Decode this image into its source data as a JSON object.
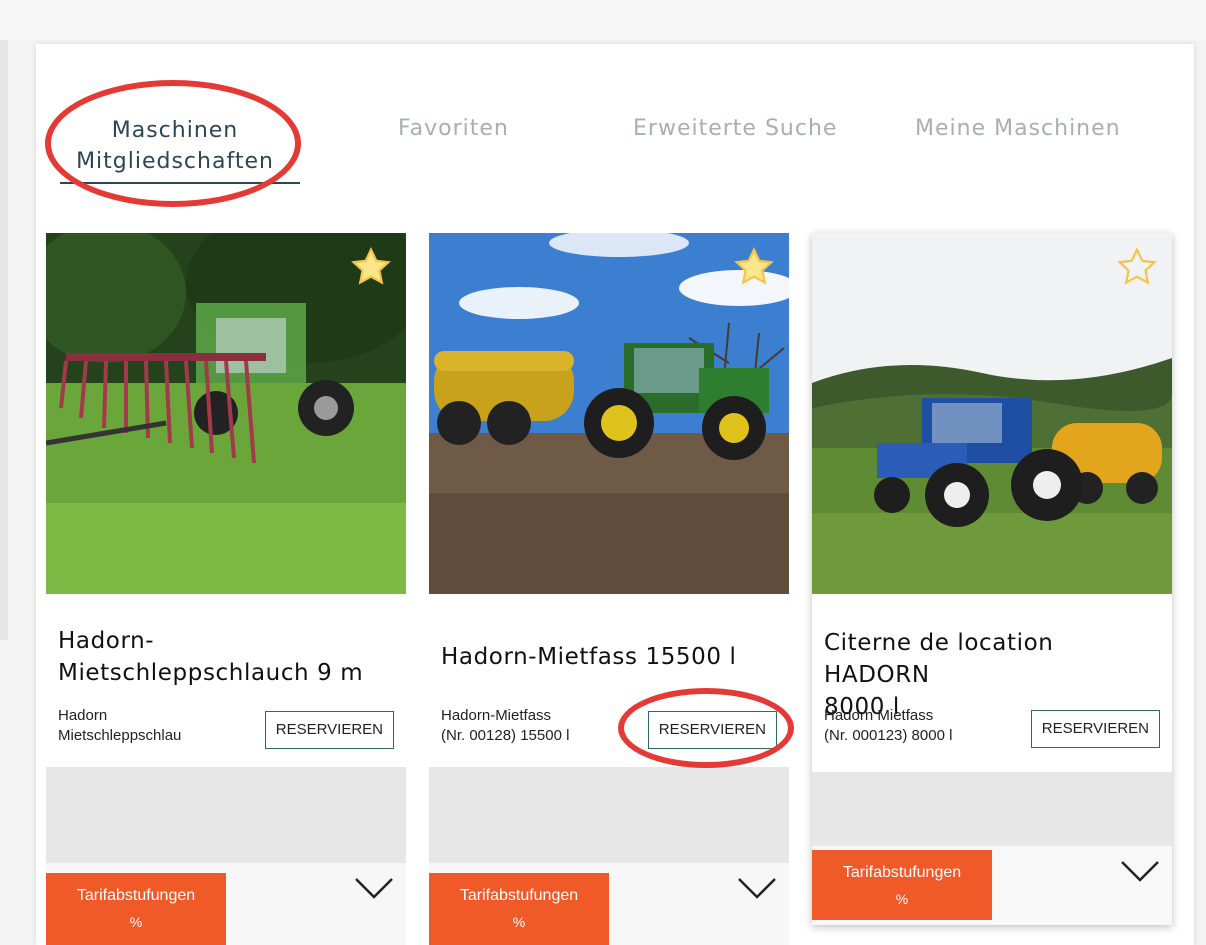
{
  "tabs": [
    {
      "label_line1": "Maschinen",
      "label_line2": "Mitgliedschaften",
      "active": true
    },
    {
      "label": "Favoriten"
    },
    {
      "label": "Erweiterte Suche"
    },
    {
      "label": "Meine Maschinen"
    }
  ],
  "cards": [
    {
      "title": "Hadorn-Mietschleppschlauch 9 m",
      "title_line1": "Hadorn-",
      "title_line2": "Mietschleppschlauch 9 m",
      "subtitle_line1": "Hadorn",
      "subtitle_line2": "Mietschleppschlau",
      "button_label": "RESERVIEREN",
      "tarif_label": "Tarifabstufungen",
      "tarif_symbol": "%",
      "favorite": true
    },
    {
      "title": "Hadorn-Mietfass 15500 l",
      "subtitle_line1": "Hadorn-Mietfass",
      "subtitle_line2": "(Nr. 00128) 15500 l",
      "button_label": "RESERVIEREN",
      "tarif_label": "Tarifabstufungen",
      "tarif_symbol": "%",
      "favorite": true
    },
    {
      "title": "Citerne de location HADORN 8000 l",
      "title_line1": "Citerne de location HADORN",
      "title_line2": "8000 l",
      "subtitle_line1": "Hadorn Mietfass",
      "subtitle_line2": "(Nr. 000123) 8000 l",
      "button_label": "RESERVIEREN",
      "tarif_label": "Tarifabstufungen",
      "tarif_symbol": "%",
      "favorite": false
    }
  ],
  "colors": {
    "accent_orange": "#f05a28",
    "tab_active": "#2d4654",
    "tab_inactive": "#a7aeb6",
    "button_border": "#2f6b55",
    "annotation_red": "#e53935",
    "star_fill": "#fde68a"
  },
  "icons": {
    "favorite": "star-icon",
    "expand": "chevron-down-icon"
  }
}
